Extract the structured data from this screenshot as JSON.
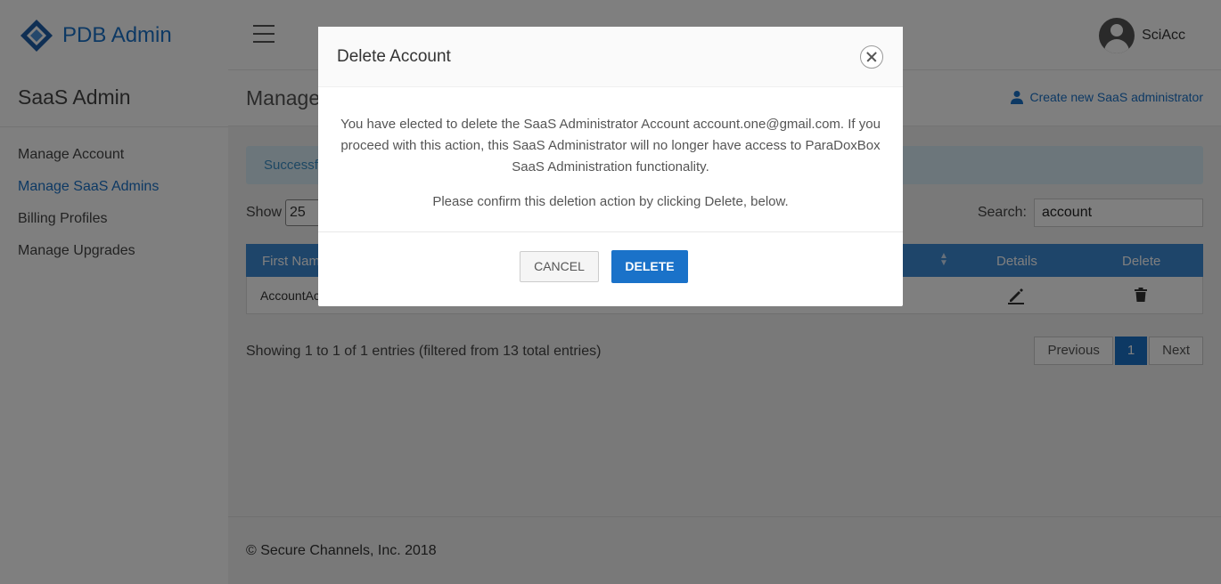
{
  "brand": {
    "name": "PDB Admin",
    "logo_icon": "diamond-logo-icon"
  },
  "sidebar": {
    "title": "SaaS Admin",
    "items": [
      {
        "label": "Manage Account",
        "active": false
      },
      {
        "label": "Manage SaaS Admins",
        "active": true
      },
      {
        "label": "Billing Profiles",
        "active": false
      },
      {
        "label": "Manage Upgrades",
        "active": false
      }
    ]
  },
  "topbar": {
    "menu_icon": "hamburger-icon",
    "user_name": "SciAcc",
    "avatar_icon": "user-avatar-icon"
  },
  "page": {
    "title": "Manage",
    "create_link": "Create new SaaS administrator",
    "alert_text": "Successf"
  },
  "table_controls": {
    "show_label": "Show",
    "page_size": "25",
    "search_label": "Search:",
    "search_value": "account"
  },
  "table": {
    "headers": {
      "first_name": "First Nam",
      "details": "Details",
      "delete": "Delete"
    },
    "rows": [
      {
        "first_name": "AccountAc"
      }
    ]
  },
  "pagination": {
    "summary": "Showing 1 to 1 of 1 entries (filtered from 13 total entries)",
    "previous": "Previous",
    "current": "1",
    "next": "Next"
  },
  "footer": {
    "text": "© Secure Channels, Inc. 2018"
  },
  "modal": {
    "title": "Delete Account",
    "message": "You have elected to delete the SaaS Administrator Account account.one@gmail.com. If you proceed with this action, this SaaS Administrator will no longer have access to ParaDoxBox SaaS Administration functionality.",
    "confirm": "Please confirm this deletion action by clicking Delete, below.",
    "cancel_label": "CANCEL",
    "delete_label": "DELETE"
  },
  "colors": {
    "accent": "#1a72c9",
    "table_header": "#3d8ad4",
    "alert_bg": "#d9ecf7"
  }
}
